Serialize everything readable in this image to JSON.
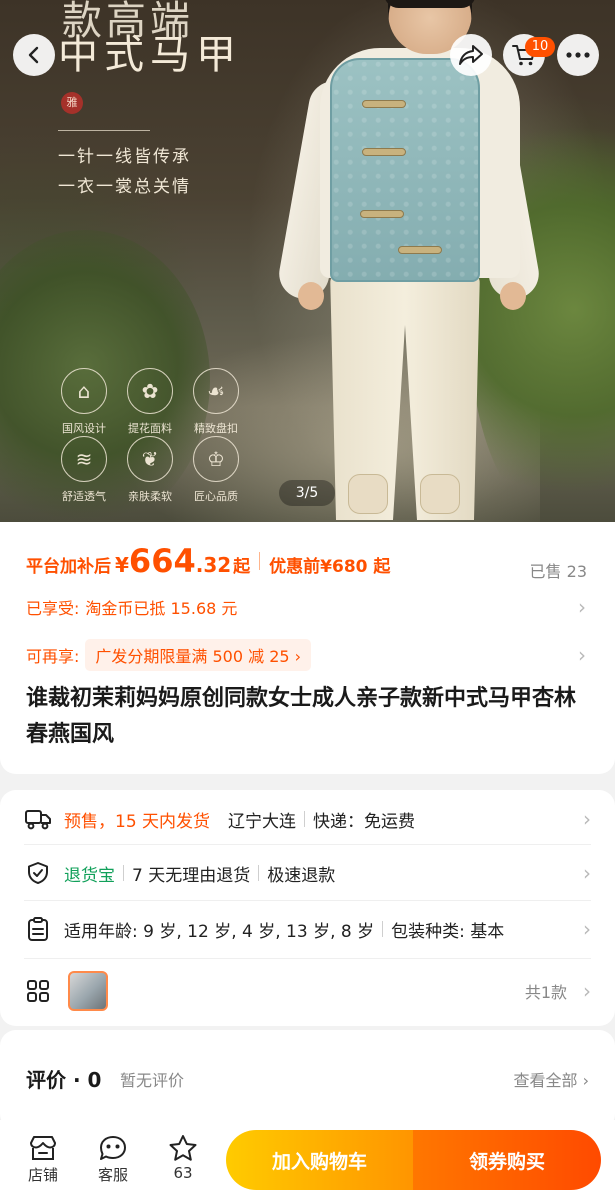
{
  "hero": {
    "title_top": "款高端",
    "title": "中式马甲",
    "seal": "雅",
    "slogan_1": "一针一线皆传承",
    "slogan_2": "一衣一裳总关情",
    "features": [
      {
        "label": "国风设计",
        "icon": "scroll-icon"
      },
      {
        "label": "提花面料",
        "icon": "flower-icon"
      },
      {
        "label": "精致盘扣",
        "icon": "knot-icon"
      },
      {
        "label": "舒适透气",
        "icon": "wind-icon"
      },
      {
        "label": "亲肤柔软",
        "icon": "leaf-icon"
      },
      {
        "label": "匠心品质",
        "icon": "crown-icon"
      }
    ],
    "page_indicator": "3/5"
  },
  "nav": {
    "cart_badge": "10"
  },
  "price": {
    "label": "平台加补后",
    "currency": "¥",
    "integer": "664",
    "decimal": ".32",
    "suffix": "起",
    "before_text": "优惠前¥680 起",
    "sold": "已售 23"
  },
  "promo": {
    "enjoyed_key": "已享受:",
    "enjoyed_text": "淘金币已抵 15.68 元",
    "again_key": "可再享:",
    "again_text": "广发分期限量满 500 减 25 ›"
  },
  "product": {
    "title": "谁裁初茉莉妈妈原创同款女士成人亲子款新中式马甲杏林春燕国风"
  },
  "info": {
    "shipping_presale": "预售，15 天内发货",
    "shipping_origin": "辽宁大连",
    "shipping_fee": "快递：免运费",
    "return_brand": "退货宝",
    "return_policy": "7 天无理由退货",
    "return_speed": "极速退款",
    "params": "适用年龄: 9 岁, 12 岁, 4 岁, 13 岁, 8 岁",
    "params_more": "包装种类: 基本",
    "variants_count": "共1款"
  },
  "review": {
    "title": "评价 · 0",
    "empty": "暂无评价",
    "view_all": "查看全部 ›"
  },
  "bottom": {
    "shop": "店铺",
    "service": "客服",
    "favorites": "63",
    "add_cart": "加入购物车",
    "buy": "领券购买"
  },
  "colors": {
    "accent": "#ff5000",
    "green": "#11a05a",
    "cart_gradient_start": "#ffcb00",
    "buy_gradient_end": "#ff4a00"
  }
}
